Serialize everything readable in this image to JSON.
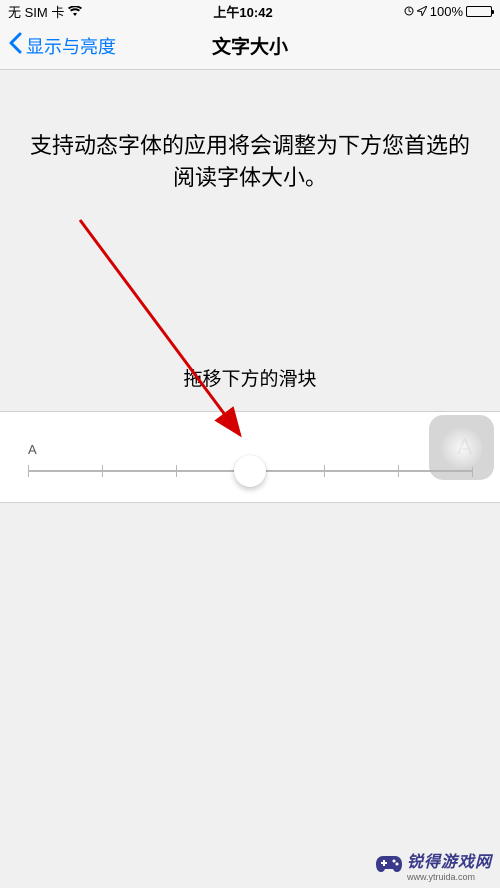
{
  "status": {
    "sim": "无 SIM 卡",
    "time": "上午10:42",
    "battery": "100%"
  },
  "nav": {
    "back_label": "显示与亮度",
    "title": "文字大小"
  },
  "main": {
    "description": "支持动态字体的应用将会调整为下方您首选的阅读字体大小。",
    "instruction": "拖移下方的滑块"
  },
  "slider": {
    "small_label": "A",
    "large_label": "A",
    "ticks": 7,
    "value_index": 3
  },
  "watermark": {
    "name": "锐得游戏网",
    "url": "www.ytruida.com"
  }
}
